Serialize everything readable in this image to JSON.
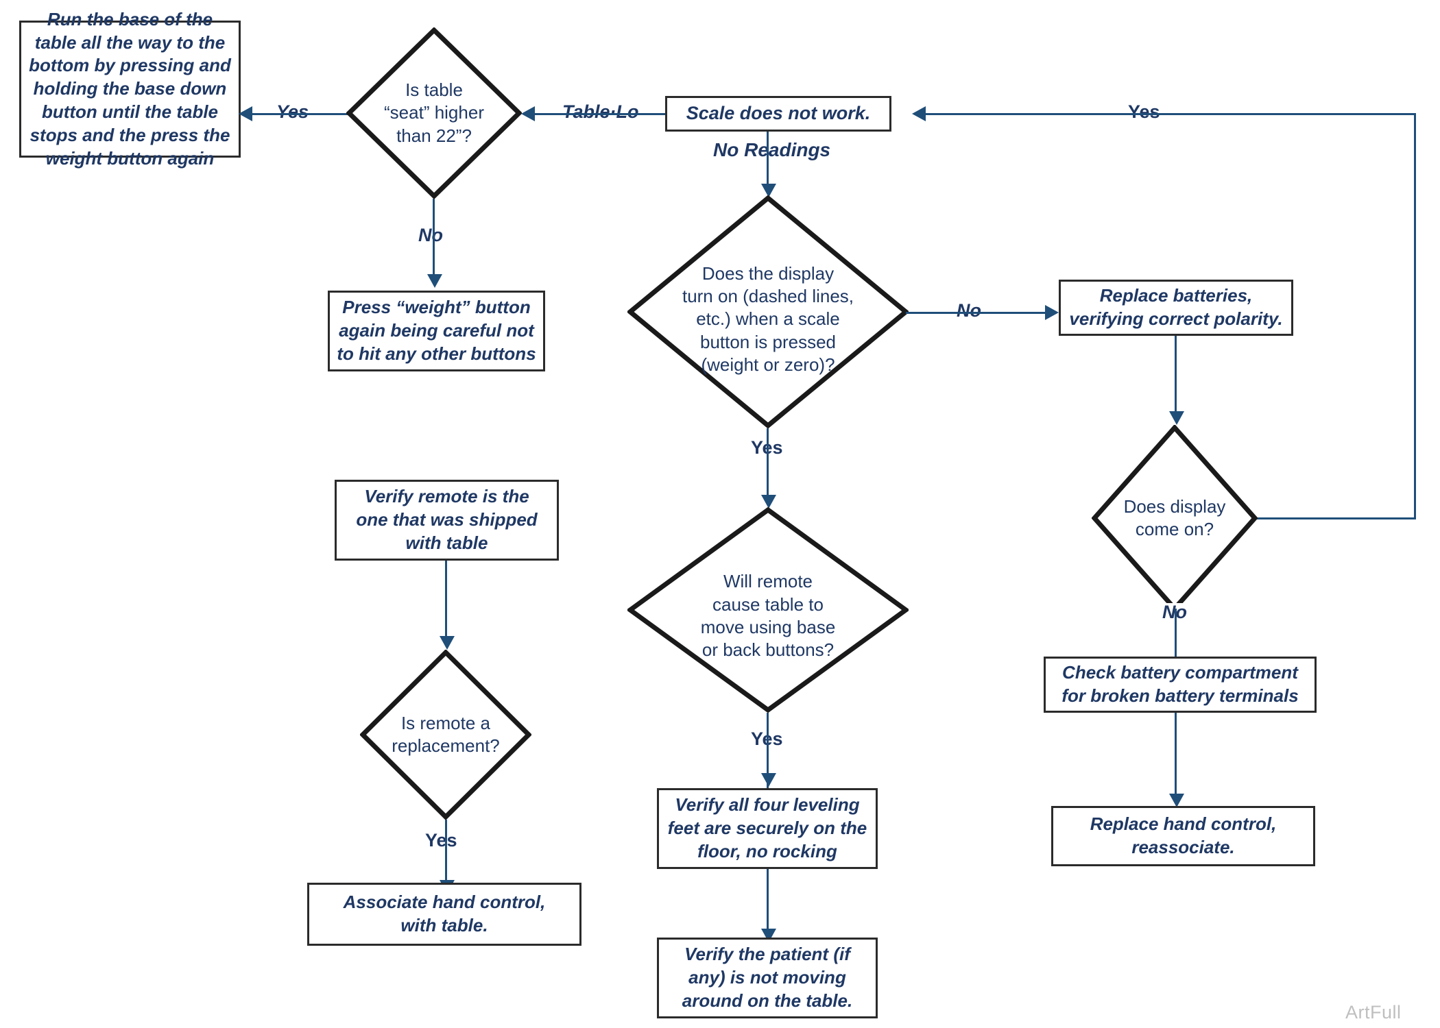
{
  "diagram": {
    "title": "Scale Troubleshooting Flowchart",
    "watermark": "ArtFull",
    "colors": {
      "text": "#1F3864",
      "connector": "#1F4E79",
      "shape_border": "#2b2b2b",
      "background": "#FFFFFF",
      "watermark": "#BFBFBF"
    }
  },
  "nodes": {
    "run_base_box": {
      "type": "process",
      "lines": [
        "Run the base of the",
        "table all the way to the",
        "bottom by pressing and",
        "holding the base down",
        "button until the table",
        "stops and the press the",
        "weight button again"
      ]
    },
    "table_seat_diamond": {
      "type": "decision",
      "lines": [
        "Is table",
        "“seat” higher",
        "than 22”?"
      ]
    },
    "press_weight_box": {
      "type": "process",
      "lines": [
        "Press “weight” button",
        "again being careful not",
        "to hit any other buttons"
      ]
    },
    "scale_does_not_work_box": {
      "type": "process",
      "lines": [
        "Scale does not work."
      ]
    },
    "display_turn_on_diamond": {
      "type": "decision",
      "lines": [
        "Does the display",
        "turn on (dashed lines,",
        "etc.) when a scale",
        "button is pressed",
        "(weight or zero)?"
      ]
    },
    "replace_batteries_box": {
      "type": "process",
      "lines": [
        "Replace batteries,",
        "verifying correct polarity."
      ]
    },
    "display_come_on_diamond": {
      "type": "decision",
      "lines": [
        "Does display",
        "come on?"
      ]
    },
    "check_battery_box": {
      "type": "process",
      "lines": [
        "Check battery compartment",
        "for broken battery terminals"
      ]
    },
    "replace_hand_control_box": {
      "type": "process",
      "lines": [
        "Replace hand control,",
        "reassociate."
      ]
    },
    "verify_remote_box": {
      "type": "process",
      "lines": [
        "Verify remote is the",
        "one that was shipped",
        "with table"
      ]
    },
    "remote_replacement_diamond": {
      "type": "decision",
      "lines": [
        "Is remote a",
        "replacement?"
      ]
    },
    "associate_hand_control_box": {
      "type": "process",
      "lines": [
        "Associate hand control,",
        "with table."
      ]
    },
    "remote_move_diamond": {
      "type": "decision",
      "lines": [
        "Will remote",
        "cause table to",
        "move using base",
        "or back buttons?"
      ]
    },
    "leveling_feet_box": {
      "type": "process",
      "lines": [
        "Verify all four leveling",
        "feet are securely on the",
        "floor, no rocking"
      ]
    },
    "patient_moving_box": {
      "type": "process",
      "lines": [
        "Verify the patient (if",
        "any) is not moving",
        "around on the table."
      ]
    }
  },
  "edges": {
    "table_lo": "Table·Lo",
    "seat_yes": "Yes",
    "seat_no": "No",
    "no_readings": "No Readings",
    "display_no": "No",
    "display_yes": "Yes",
    "come_on_yes": "Yes",
    "come_on_no": "No",
    "remote_move_yes": "Yes",
    "remote_replacement_yes": "Yes"
  }
}
